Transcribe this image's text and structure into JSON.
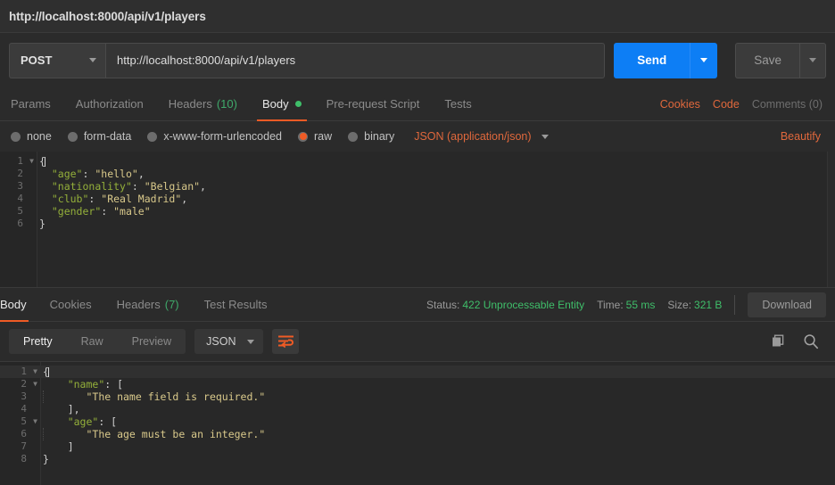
{
  "window": {
    "title": "http://localhost:8000/api/v1/players"
  },
  "request": {
    "method": "POST",
    "url": "http://localhost:8000/api/v1/players",
    "send_label": "Send",
    "save_label": "Save",
    "tabs": [
      {
        "label": "Params",
        "active": false
      },
      {
        "label": "Authorization",
        "active": false
      },
      {
        "label": "Headers",
        "count": "(10)",
        "active": false
      },
      {
        "label": "Body",
        "active": true,
        "dot": true
      },
      {
        "label": "Pre-request Script",
        "active": false
      },
      {
        "label": "Tests",
        "active": false
      }
    ],
    "actions": {
      "cookies": "Cookies",
      "code": "Code",
      "comments": "Comments (0)"
    },
    "body_types": [
      {
        "label": "none",
        "selected": false
      },
      {
        "label": "form-data",
        "selected": false
      },
      {
        "label": "x-www-form-urlencoded",
        "selected": false
      },
      {
        "label": "raw",
        "selected": true
      },
      {
        "label": "binary",
        "selected": false
      }
    ],
    "content_type": "JSON (application/json)",
    "beautify_label": "Beautify",
    "body_lines": [
      {
        "n": "1",
        "fold": true,
        "segments": [
          {
            "t": "{",
            "c": "punct"
          }
        ],
        "caret": true
      },
      {
        "n": "2",
        "fold": false,
        "segments": [
          {
            "t": "  ",
            "c": "punct"
          },
          {
            "t": "\"age\"",
            "c": "key"
          },
          {
            "t": ": ",
            "c": "punct"
          },
          {
            "t": "\"hello\"",
            "c": "str"
          },
          {
            "t": ",",
            "c": "punct"
          }
        ]
      },
      {
        "n": "3",
        "fold": false,
        "segments": [
          {
            "t": "  ",
            "c": "punct"
          },
          {
            "t": "\"nationality\"",
            "c": "key"
          },
          {
            "t": ": ",
            "c": "punct"
          },
          {
            "t": "\"Belgian\"",
            "c": "str"
          },
          {
            "t": ",",
            "c": "punct"
          }
        ]
      },
      {
        "n": "4",
        "fold": false,
        "segments": [
          {
            "t": "  ",
            "c": "punct"
          },
          {
            "t": "\"club\"",
            "c": "key"
          },
          {
            "t": ": ",
            "c": "punct"
          },
          {
            "t": "\"Real Madrid\"",
            "c": "str"
          },
          {
            "t": ",",
            "c": "punct"
          }
        ]
      },
      {
        "n": "5",
        "fold": false,
        "segments": [
          {
            "t": "  ",
            "c": "punct"
          },
          {
            "t": "\"gender\"",
            "c": "key"
          },
          {
            "t": ": ",
            "c": "punct"
          },
          {
            "t": "\"male\"",
            "c": "str"
          }
        ]
      },
      {
        "n": "6",
        "fold": false,
        "segments": [
          {
            "t": "}",
            "c": "punct"
          }
        ]
      }
    ]
  },
  "response": {
    "tabs": [
      {
        "label": "Body",
        "active": true
      },
      {
        "label": "Cookies",
        "active": false
      },
      {
        "label": "Headers",
        "count": "(7)",
        "active": false
      },
      {
        "label": "Test Results",
        "active": false
      }
    ],
    "status": {
      "label": "Status:",
      "value": "422 Unprocessable Entity"
    },
    "time": {
      "label": "Time:",
      "value": "55 ms"
    },
    "size": {
      "label": "Size:",
      "value": "321 B"
    },
    "download_label": "Download",
    "view_modes": [
      {
        "label": "Pretty",
        "active": true
      },
      {
        "label": "Raw",
        "active": false
      },
      {
        "label": "Preview",
        "active": false
      }
    ],
    "format": "JSON",
    "body_lines": [
      {
        "n": "1",
        "fold": true,
        "segments": [
          {
            "t": "{",
            "c": "punct"
          }
        ],
        "caret": true,
        "highlight": true
      },
      {
        "n": "2",
        "fold": true,
        "segments": [
          {
            "t": "    ",
            "c": "punct"
          },
          {
            "t": "\"name\"",
            "c": "key"
          },
          {
            "t": ": [",
            "c": "punct"
          }
        ]
      },
      {
        "n": "3",
        "fold": false,
        "guide": true,
        "segments": [
          {
            "t": "       ",
            "c": "punct"
          },
          {
            "t": "\"The name field is required.\"",
            "c": "str"
          }
        ]
      },
      {
        "n": "4",
        "fold": false,
        "segments": [
          {
            "t": "    ],",
            "c": "punct"
          }
        ]
      },
      {
        "n": "5",
        "fold": true,
        "segments": [
          {
            "t": "    ",
            "c": "punct"
          },
          {
            "t": "\"age\"",
            "c": "key"
          },
          {
            "t": ": [",
            "c": "punct"
          }
        ]
      },
      {
        "n": "6",
        "fold": false,
        "guide": true,
        "segments": [
          {
            "t": "       ",
            "c": "punct"
          },
          {
            "t": "\"The age must be an integer.\"",
            "c": "str"
          }
        ]
      },
      {
        "n": "7",
        "fold": false,
        "segments": [
          {
            "t": "    ]",
            "c": "punct"
          }
        ]
      },
      {
        "n": "8",
        "fold": false,
        "segments": [
          {
            "t": "}",
            "c": "punct"
          }
        ]
      }
    ]
  },
  "colors": {
    "accent_orange": "#ef5b25",
    "send_blue": "#0d7ef5",
    "status_green": "#3fbf6a",
    "json_key": "#94b03a",
    "json_string": "#d9c98b",
    "background": "#2b2b2b"
  }
}
